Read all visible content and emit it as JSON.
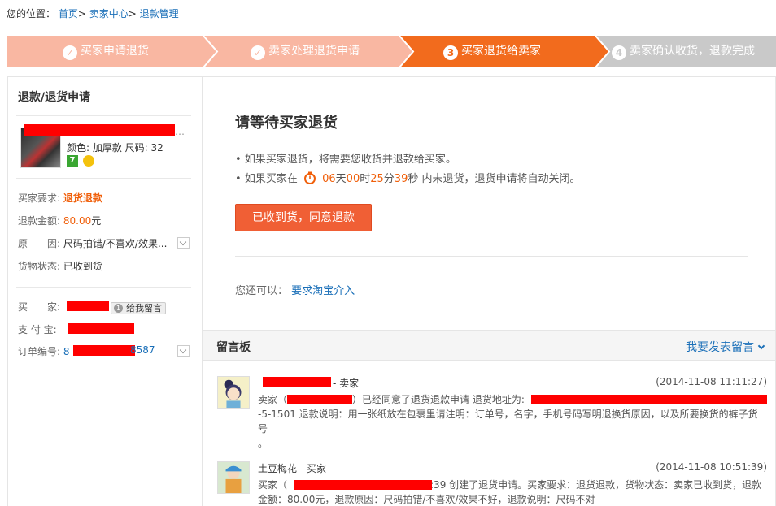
{
  "breadcrumb": {
    "prefix": "您的位置：",
    "items": [
      "首页",
      "卖家中心",
      "退款管理"
    ]
  },
  "steps": [
    {
      "label": "买家申请退货",
      "state": "done"
    },
    {
      "label": "卖家处理退货申请",
      "state": "done"
    },
    {
      "num": "3",
      "label": "买家退货给卖家",
      "state": "active"
    },
    {
      "num": "4",
      "label": "卖家确认收货，退款完成",
      "state": "todo"
    }
  ],
  "colors": {
    "done": "#f9b7a2",
    "active": "#f26b1d",
    "todo": "#c9c9c9",
    "accent": "#f05f35",
    "link": "#1a6fb8"
  },
  "sidebar": {
    "title": "退款/退货申请",
    "product_spec": "颜色: 加厚款  尺码: 32",
    "badge_num": "7",
    "request_label": "买家要求:",
    "request_value": "退货退款",
    "amount_label": "退款金额:",
    "amount_value": "80.00",
    "amount_unit": "元",
    "reason_label": "原　　因:",
    "reason_value": "尺码拍错/不喜欢/效果...",
    "goods_label": "货物状态:",
    "goods_value": "已收到货",
    "buyer_label": "买　　家:",
    "msg_tip": "给我留言",
    "alipay_label": "支 付 宝:",
    "order_label": "订单编号:",
    "order_prefix": "8",
    "order_suffix": "8587"
  },
  "main": {
    "title": "请等待买家退货",
    "bullet1": "如果买家退货，将需要您收货并退款给买家。",
    "bullet2_prefix": "如果买家在",
    "days": "06",
    "days_unit": "天",
    "hours": "00",
    "hours_unit": "时",
    "mins": "25",
    "mins_unit": "分",
    "secs": "39",
    "secs_unit": "秒",
    "bullet2_suffix": " 内未退货，退货申请将自动关闭。",
    "agree_button": "已收到货，同意退款",
    "also_label": "您还可以：",
    "also_link": "要求淘宝介入"
  },
  "board": {
    "title": "留言板",
    "post_link": "我要发表留言",
    "messages": [
      {
        "who": "- 卖家",
        "time": "(2014-11-08 11:11:27)",
        "line1_prefix": "卖家（",
        "line1_mid": "）已经同意了退货退款申请 退货地址为:",
        "line2": "-5-1501 退款说明：用一张纸放在包裹里请注明：订单号，名字，手机号码写明退换货原因，以及所要换货的裤子货号",
        "line3": "。"
      },
      {
        "who": "土豆梅花 - 买家",
        "time": "(2014-11-08 10:51:39)",
        "line1_prefix": "买家（",
        "line1_mid": ":39 创建了退货申请。买家要求：退货退款，货物状态：卖家已收到货，退款",
        "line2": "金额：80.00元，退款原因：尺码拍错/不喜欢/效果不好，退款说明：尺码不对"
      }
    ]
  }
}
